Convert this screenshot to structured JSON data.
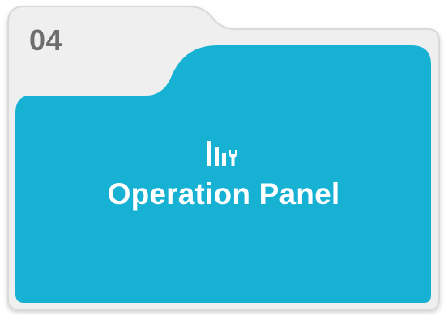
{
  "folder": {
    "tab_number": "04",
    "title": "Operation Panel",
    "icon": "operation-panel-icon",
    "colors": {
      "accent": "#17b1d4",
      "back_panel": "#efefef",
      "border": "#d9d9d9",
      "number": "#6e6e6e",
      "title": "#ffffff"
    }
  }
}
